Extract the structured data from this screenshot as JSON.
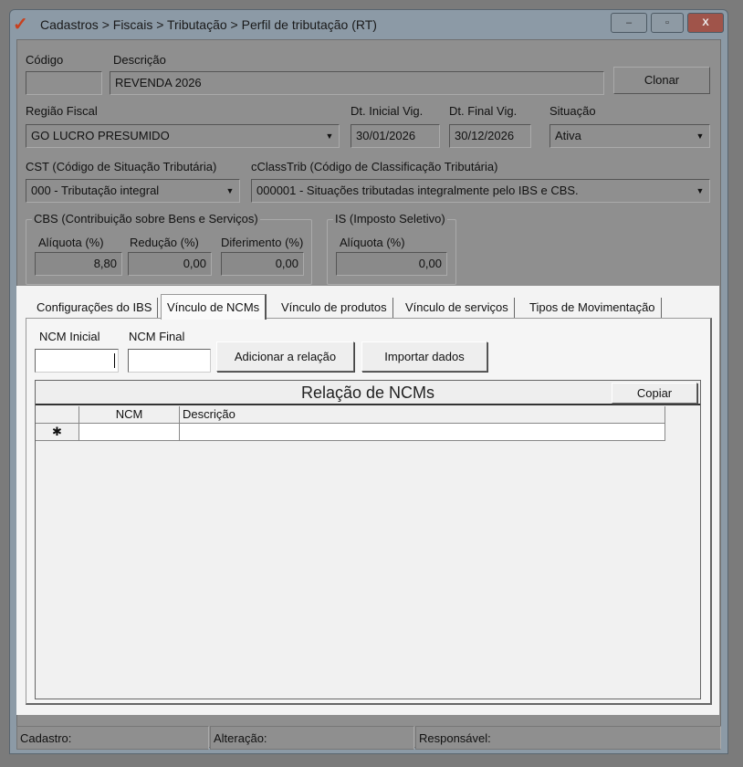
{
  "window": {
    "title": "Cadastros > Fiscais > Tributação > Perfil de tributação (RT)",
    "minimize": "–",
    "maximize": "▫",
    "close": "X"
  },
  "form": {
    "codigo_label": "Código",
    "codigo_value": "",
    "descricao_label": "Descrição",
    "descricao_value": "REVENDA 2026",
    "clonar": "Clonar",
    "regiao_label": "Região Fiscal",
    "regiao_value": "GO LUCRO PRESUMIDO",
    "dt_inicial_label": "Dt. Inicial Vig.",
    "dt_inicial_value": "30/01/2026",
    "dt_final_label": "Dt. Final Vig.",
    "dt_final_value": "30/12/2026",
    "situacao_label": "Situação",
    "situacao_value": "Ativa",
    "cst_label": "CST (Código de Situação Tributária)",
    "cst_value": "000 - Tributação integral",
    "cclass_label": "cClassTrib (Código de Classificação Tributária)",
    "cclass_value": "000001 - Situações tributadas integralmente pelo IBS e CBS."
  },
  "cbs": {
    "caption": "CBS (Contribuição sobre Bens e Serviços)",
    "aliquota_label": "Alíquota (%)",
    "aliquota": "8,80",
    "reducao_label": "Redução (%)",
    "reducao": "0,00",
    "diferimento_label": "Diferimento (%)",
    "diferimento": "0,00"
  },
  "is": {
    "caption": "IS (Imposto Seletivo)",
    "aliquota_label": "Alíquota (%)",
    "aliquota": "0,00"
  },
  "tabs": [
    {
      "label": "Configurações do IBS"
    },
    {
      "label": "Vínculo de NCMs"
    },
    {
      "label": "Vínculo de produtos"
    },
    {
      "label": "Vínculo de serviços"
    },
    {
      "label": "Tipos de Movimentação"
    }
  ],
  "ncm": {
    "inicial_label": "NCM Inicial",
    "inicial_value": "",
    "final_label": "NCM Final",
    "final_value": "",
    "adicionar": "Adicionar a relação",
    "importar": "Importar dados",
    "grid_title": "Relação de NCMs",
    "copiar": "Copiar",
    "columns": [
      "NCM",
      "Descrição"
    ],
    "new_row_marker": "✱"
  },
  "statusbar": {
    "cadastro": "Cadastro:",
    "alteracao": "Alteração:",
    "responsavel": "Responsável:"
  }
}
